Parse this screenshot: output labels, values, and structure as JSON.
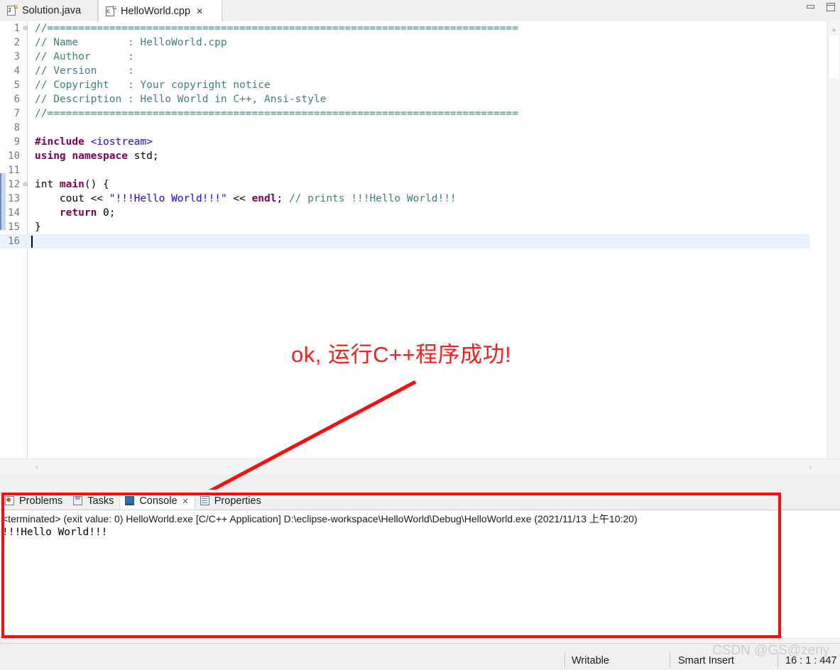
{
  "window": {
    "minimize_label": "Minimize",
    "maximize_label": "Maximize"
  },
  "editor_tabs": [
    {
      "label": "Solution.java",
      "icon": "java-file-icon",
      "badge": "J",
      "active": false,
      "closable": false
    },
    {
      "label": "HelloWorld.cpp",
      "icon": "cpp-file-icon",
      "badge": "c",
      "active": true,
      "closable": true,
      "close_glyph": "✕"
    }
  ],
  "editor": {
    "lines": [
      {
        "no": "1",
        "fold": "⊖",
        "current": false,
        "segments": [
          {
            "cls": "cm",
            "text": "//============================================================================"
          }
        ]
      },
      {
        "no": "2",
        "fold": "",
        "current": false,
        "segments": [
          {
            "cls": "cm",
            "text": "// Name        : HelloWorld.cpp"
          }
        ]
      },
      {
        "no": "3",
        "fold": "",
        "current": false,
        "segments": [
          {
            "cls": "cm",
            "text": "// Author      : "
          }
        ]
      },
      {
        "no": "4",
        "fold": "",
        "current": false,
        "segments": [
          {
            "cls": "cm",
            "text": "// Version     : "
          }
        ]
      },
      {
        "no": "5",
        "fold": "",
        "current": false,
        "segments": [
          {
            "cls": "cm",
            "text": "// Copyright   : Your copyright notice"
          }
        ]
      },
      {
        "no": "6",
        "fold": "",
        "current": false,
        "segments": [
          {
            "cls": "cm",
            "text": "// Description : Hello World in C++, Ansi-style"
          }
        ]
      },
      {
        "no": "7",
        "fold": "",
        "current": false,
        "segments": [
          {
            "cls": "cm",
            "text": "//============================================================================"
          }
        ]
      },
      {
        "no": "8",
        "fold": "",
        "current": false,
        "segments": [
          {
            "cls": "pl",
            "text": ""
          }
        ]
      },
      {
        "no": "9",
        "fold": "",
        "current": false,
        "segments": [
          {
            "cls": "pp",
            "text": "#include"
          },
          {
            "cls": "pl",
            "text": " "
          },
          {
            "cls": "hdr",
            "text": "<iostream>"
          }
        ]
      },
      {
        "no": "10",
        "fold": "",
        "current": false,
        "segments": [
          {
            "cls": "kw",
            "text": "using namespace"
          },
          {
            "cls": "pl",
            "text": " std;"
          }
        ]
      },
      {
        "no": "11",
        "fold": "",
        "current": false,
        "segments": [
          {
            "cls": "pl",
            "text": ""
          }
        ]
      },
      {
        "no": "12",
        "fold": "⊖",
        "current": false,
        "segments": [
          {
            "cls": "pl",
            "text": "int "
          },
          {
            "cls": "kw",
            "text": "main"
          },
          {
            "cls": "pl",
            "text": "() {"
          }
        ]
      },
      {
        "no": "13",
        "fold": "",
        "current": false,
        "segments": [
          {
            "cls": "pl",
            "text": "    cout << "
          },
          {
            "cls": "str",
            "text": "\"!!!Hello World!!!\""
          },
          {
            "cls": "pl",
            "text": " << "
          },
          {
            "cls": "kw",
            "text": "endl"
          },
          {
            "cls": "pl",
            "text": "; "
          },
          {
            "cls": "cm",
            "text": "// prints !!!Hello World!!!"
          }
        ]
      },
      {
        "no": "14",
        "fold": "",
        "current": false,
        "segments": [
          {
            "cls": "pl",
            "text": "    "
          },
          {
            "cls": "kw",
            "text": "return"
          },
          {
            "cls": "pl",
            "text": " 0;"
          }
        ]
      },
      {
        "no": "15",
        "fold": "",
        "current": false,
        "segments": [
          {
            "cls": "pl",
            "text": "}"
          }
        ]
      },
      {
        "no": "16",
        "fold": "",
        "current": true,
        "segments": [
          {
            "cls": "pl",
            "text": ""
          }
        ]
      }
    ],
    "scroll_up_glyph": "▲",
    "scroll_down_glyph": "▼",
    "scroll_left_glyph": "‹",
    "scroll_right_glyph": "›"
  },
  "annotation": {
    "text": "ok, 运行C++程序成功!",
    "color": "#ff1c1c"
  },
  "panel_tabs": [
    {
      "label": "Problems",
      "icon": "problems-icon",
      "active": false,
      "closable": false
    },
    {
      "label": "Tasks",
      "icon": "tasks-icon",
      "active": false,
      "closable": false
    },
    {
      "label": "Console",
      "icon": "console-icon",
      "active": true,
      "closable": true,
      "close_glyph": "✕"
    },
    {
      "label": "Properties",
      "icon": "properties-icon",
      "active": false,
      "closable": false
    }
  ],
  "console": {
    "header": "<terminated> (exit value: 0) HelloWorld.exe [C/C++ Application] D:\\eclipse-workspace\\HelloWorld\\Debug\\HelloWorld.exe (2021/11/13 上午10:20)",
    "output": "!!!Hello World!!!"
  },
  "statusbar": {
    "writable": "Writable",
    "insert_mode": "Smart Insert",
    "cursor_position": "16 : 1 : 447"
  },
  "watermark": {
    "text": "CSDN @GS@zeny"
  },
  "highlight_box": {
    "color": "#fb0d0d"
  }
}
